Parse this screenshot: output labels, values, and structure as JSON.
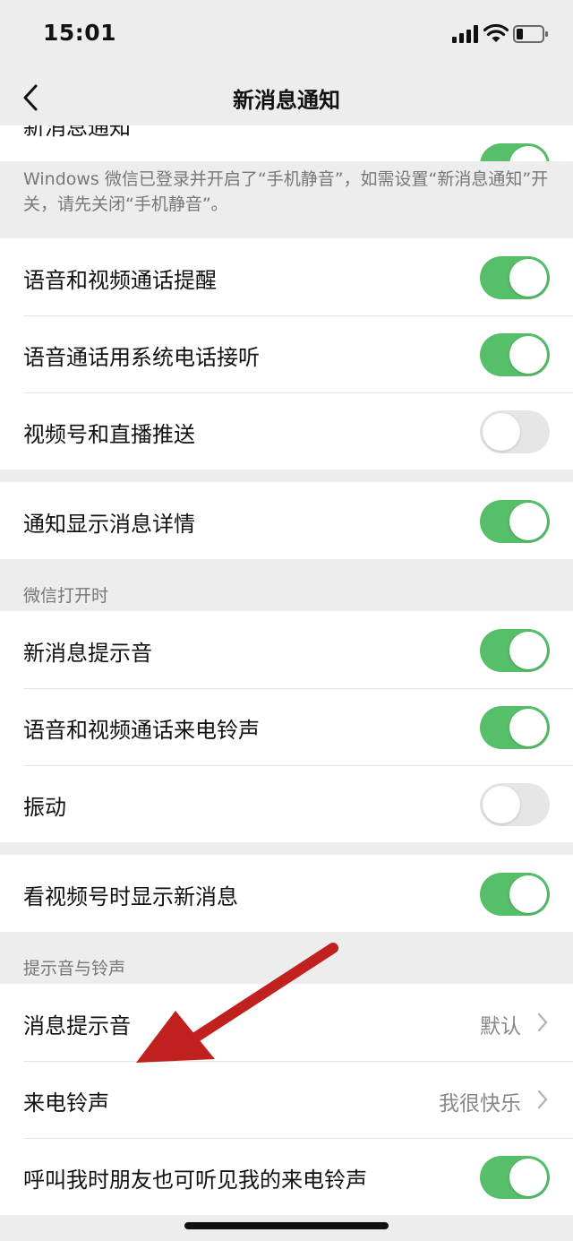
{
  "status_bar": {
    "time": "15:01"
  },
  "navbar": {
    "title": "新消息通知"
  },
  "peek_row": {
    "label": "新消息通知",
    "toggle_on": true
  },
  "notice": "Windows 微信已登录并开启了“手机静音”，如需设置“新消息通知”开关，请先关闭“手机静音”。",
  "group1": [
    {
      "label": "语音和视频通话提醒",
      "toggle_on": true
    },
    {
      "label": "语音通话用系统电话接听",
      "toggle_on": true
    },
    {
      "label": "视频号和直播推送",
      "toggle_on": false
    }
  ],
  "group2": [
    {
      "label": "通知显示消息详情",
      "toggle_on": true
    }
  ],
  "section_open": "微信打开时",
  "group3": [
    {
      "label": "新消息提示音",
      "toggle_on": true
    },
    {
      "label": "语音和视频通话来电铃声",
      "toggle_on": true
    },
    {
      "label": "振动",
      "toggle_on": false
    }
  ],
  "group4": [
    {
      "label": "看视频号时显示新消息",
      "toggle_on": true
    }
  ],
  "section_sound": "提示音与铃声",
  "group5": [
    {
      "label": "消息提示音",
      "value": "默认"
    },
    {
      "label": "来电铃声",
      "value": "我很快乐"
    },
    {
      "label": "呼叫我时朋友也可听见我的来电铃声",
      "toggle_on": true
    }
  ],
  "colors": {
    "toggle_on": "#57be6a",
    "toggle_off": "#e6e6e6",
    "annotation_arrow": "#c0201e"
  }
}
